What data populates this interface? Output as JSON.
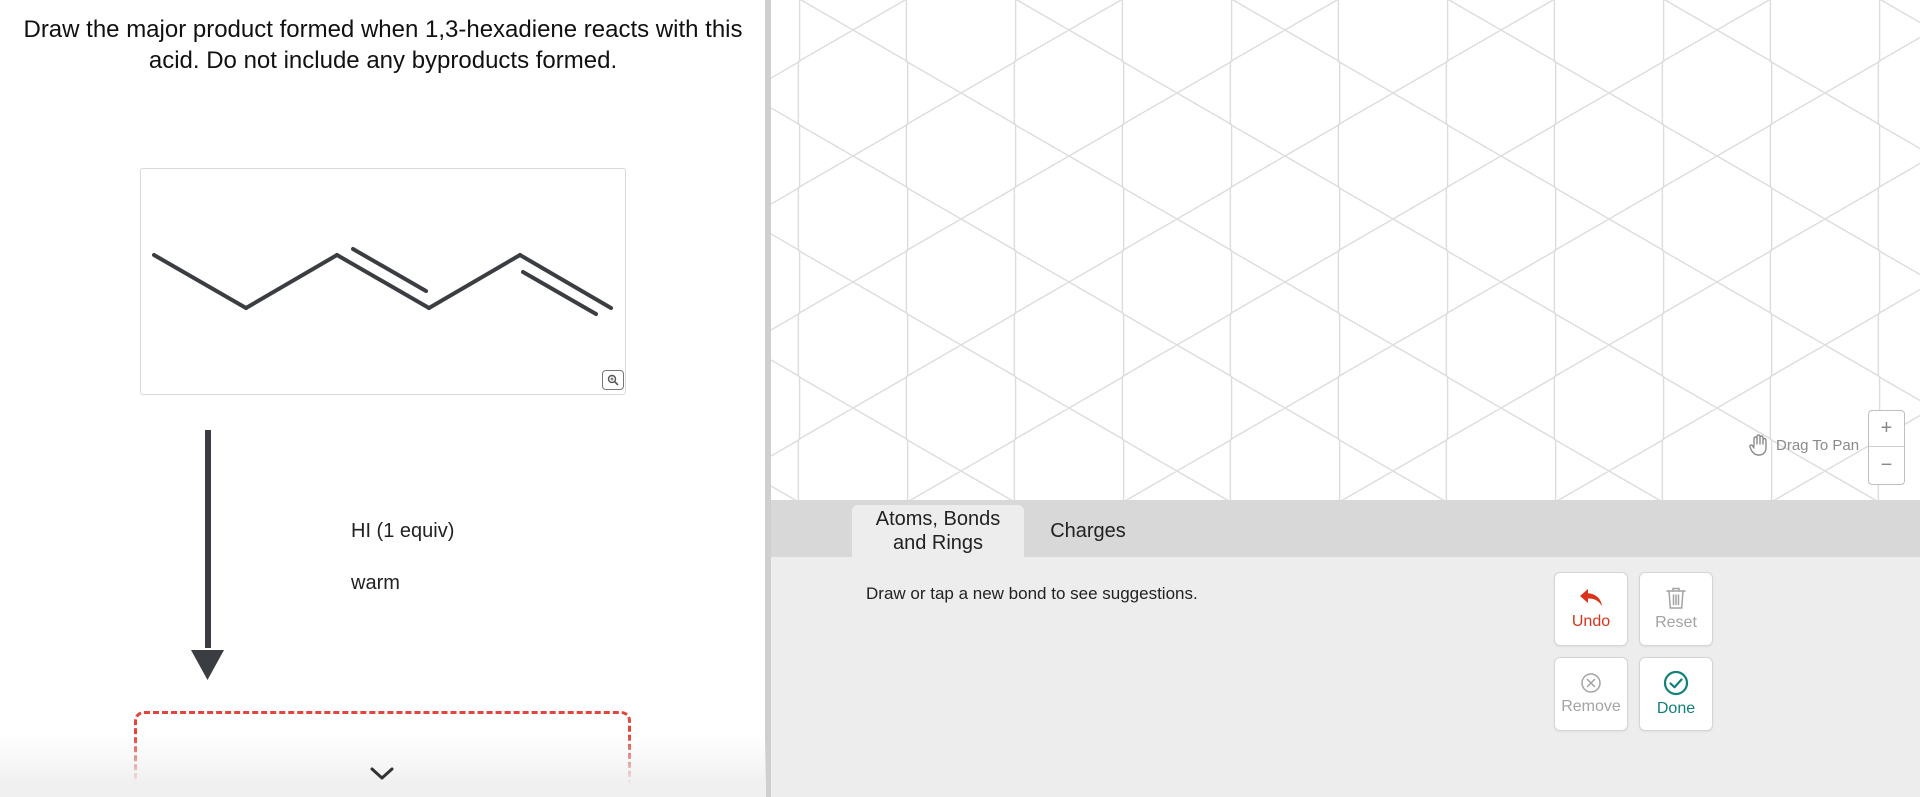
{
  "question": {
    "prompt": "Draw the major product formed when 1,3-hexadiene reacts with this acid.  Do not include any byproducts formed.",
    "reactant_structure": "1,3-hexadiene (skeletal structure)",
    "zoom_icon": "magnify-icon",
    "reagents": [
      "HI (1 equiv)",
      "warm"
    ],
    "answer_status": "empty"
  },
  "canvas": {
    "pan_hint": "Drag To Pan",
    "pan_icon": "hand-icon",
    "zoom_in": "+",
    "zoom_out": "−"
  },
  "toolbar": {
    "tabs": [
      {
        "label": "Atoms, Bonds and Rings",
        "active": true
      },
      {
        "label": "Charges",
        "active": false
      }
    ],
    "hint": "Draw or tap a new bond to see suggestions.",
    "buttons": {
      "undo": {
        "label": "Undo",
        "icon": "undo-arrow-icon"
      },
      "reset": {
        "label": "Reset",
        "icon": "trash-icon"
      },
      "remove": {
        "label": "Remove",
        "icon": "circle-x-icon"
      },
      "done": {
        "label": "Done",
        "icon": "circle-check-icon"
      }
    }
  },
  "colors": {
    "accent_error": "#e0463c",
    "undo": "#d9331c",
    "done": "#11807a",
    "disabled": "#a3a3a3",
    "bond": "#3a3d42"
  }
}
